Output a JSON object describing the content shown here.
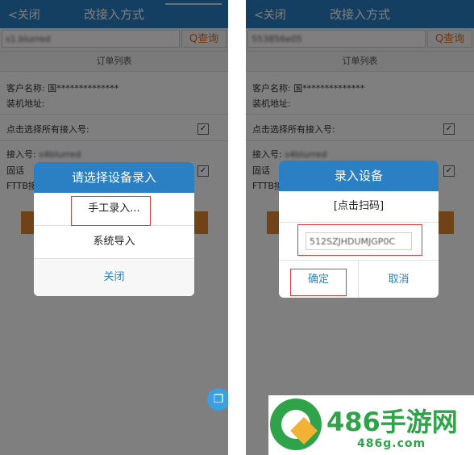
{
  "left": {
    "back_label": "<关闭",
    "title": "改接入方式",
    "search_value": "s1.blurred",
    "search_button": "Q查询",
    "list_header": "订单列表",
    "customer_label": "客户名称:",
    "customer_value": "国**************",
    "address_label": "装机地址:",
    "select_all_label": "点击选择所有接入号:",
    "access_label": "接入号:",
    "access_value": "s4blurred",
    "fixed_label": "固话",
    "ftth_label": "FTTB接",
    "dialog": {
      "title": "请选择设备录入",
      "option_manual": "手工录入...",
      "option_import": "系统导入",
      "close": "关闭"
    }
  },
  "right": {
    "back_label": "<关闭",
    "title": "改接入方式",
    "search_value": "553856e05",
    "search_button": "Q查询",
    "list_header": "订单列表",
    "customer_label": "客户名称:",
    "customer_value": "国**************",
    "address_label": "装机地址:",
    "select_all_label": "点击选择所有接入号:",
    "access_label": "接入号:",
    "access_value": "s4blurred",
    "fixed_label": "固话",
    "ftth_label": "FTTB接",
    "dialog": {
      "title": "录入设备",
      "scan_label": "[点击扫码]",
      "input_value": "512SZJHDUMJGP0C",
      "confirm": "确定",
      "cancel": "取消"
    }
  },
  "watermark": {
    "title": "486手游网",
    "url": "486g.com"
  },
  "colors": {
    "header_blue": "#2b7fc3",
    "search_orange": "#e66b1a",
    "highlight_red": "#e03b3b",
    "watermark_green": "#2fa34a"
  }
}
